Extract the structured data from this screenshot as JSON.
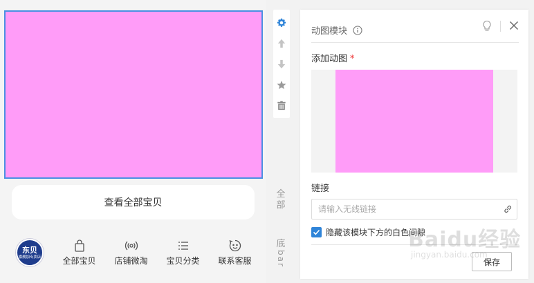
{
  "preview": {
    "view_all_label": "查看全部宝贝",
    "logo": {
      "text_big": "东贝",
      "text_small": "旗舰加专卖店"
    },
    "nav": [
      {
        "label": "全部宝贝",
        "icon": "shopping-bag-icon"
      },
      {
        "label": "店铺微淘",
        "icon": "broadcast-icon"
      },
      {
        "label": "宝贝分类",
        "icon": "list-icon"
      },
      {
        "label": "联系客服",
        "icon": "chat-smile-icon"
      }
    ],
    "gif_color": "#ff9cf8"
  },
  "toolbar": {
    "items": [
      "gear-icon",
      "arrow-up-icon",
      "arrow-down-icon",
      "star-icon",
      "trash-icon"
    ],
    "active_color": "#2f84d8",
    "inactive_color": "#b5b5b5"
  },
  "side_tabs": {
    "tab1": "全部",
    "tab2_top": "底",
    "tab2_rot": "bar"
  },
  "panel": {
    "title": "动图模块",
    "image_label": "添加动图",
    "required_mark": "*",
    "link_label": "链接",
    "link_placeholder": "请输入无线链接",
    "link_value": "",
    "checkbox_label": "隐藏该模块下方的白色间隙",
    "checkbox_checked": true,
    "save_label": "保存"
  },
  "watermark": {
    "main": "Baidu经验",
    "sub": "jingyan.baidu.com"
  }
}
